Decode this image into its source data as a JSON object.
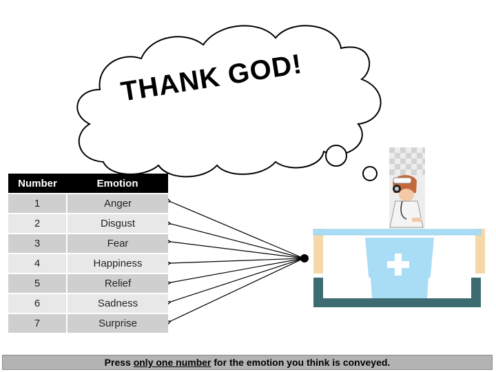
{
  "thought": {
    "text": "THANK GOD!"
  },
  "table": {
    "headers": {
      "number": "Number",
      "emotion": "Emotion"
    },
    "rows": [
      {
        "number": "1",
        "emotion": "Anger"
      },
      {
        "number": "2",
        "emotion": "Disgust"
      },
      {
        "number": "3",
        "emotion": "Fear"
      },
      {
        "number": "4",
        "emotion": "Happiness"
      },
      {
        "number": "5",
        "emotion": "Relief"
      },
      {
        "number": "6",
        "emotion": "Sadness"
      },
      {
        "number": "7",
        "emotion": "Surprise"
      }
    ]
  },
  "instruction": {
    "prefix": "Press ",
    "emphasis": "only one number",
    "suffix": " for the emotion you think is conveyed."
  },
  "colors": {
    "table_header": "#000000",
    "row_odd": "#cfcfcf",
    "row_even": "#e8e8e8",
    "bed_blue": "#a9dcf5",
    "bed_frame": "#3d6b72",
    "bed_post": "#f6d7a8"
  },
  "icons": {
    "cloud": "thought-cloud",
    "nurse": "nurse-figure",
    "bed": "hospital-bed-icon",
    "cross": "medical-cross-icon"
  }
}
